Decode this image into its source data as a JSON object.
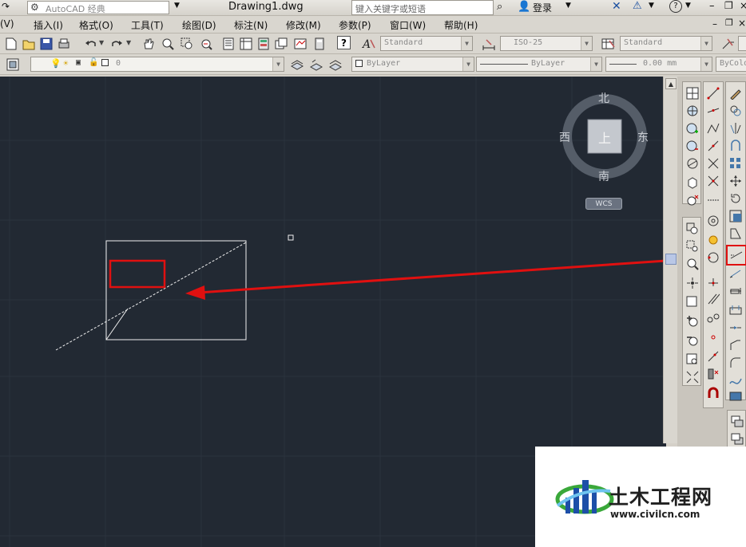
{
  "titlebar": {
    "left_partial": "(V)",
    "workspace": "AutoCAD 经典",
    "document_title": "Drawing1.dwg",
    "search_placeholder": "键入关键字或短语",
    "login": "登录",
    "help_icon": "?"
  },
  "menu": {
    "items": [
      "(V)",
      "插入(I)",
      "格式(O)",
      "工具(T)",
      "绘图(D)",
      "标注(N)",
      "修改(M)",
      "参数(P)",
      "窗口(W)",
      "帮助(H)"
    ]
  },
  "styles_toolbar": {
    "text_style": "Standard",
    "dim_style": "ISO-25",
    "table_style": "Standard"
  },
  "layers_toolbar": {
    "layer": "0",
    "color": "ByLayer",
    "linetype": "ByLayer",
    "lineweight": "0.00 mm",
    "plotstyle": "ByColo"
  },
  "viewcube": {
    "north": "北",
    "south": "南",
    "east": "东",
    "west": "西",
    "top_face": "上",
    "ucs": "WCS"
  },
  "watermark": {
    "title": "土木工程网",
    "url": "www.civilcn.com"
  },
  "colors": {
    "canvas": "#222933",
    "highlight_red": "#e01010",
    "toolbar_bg": "#d9d6cf"
  }
}
